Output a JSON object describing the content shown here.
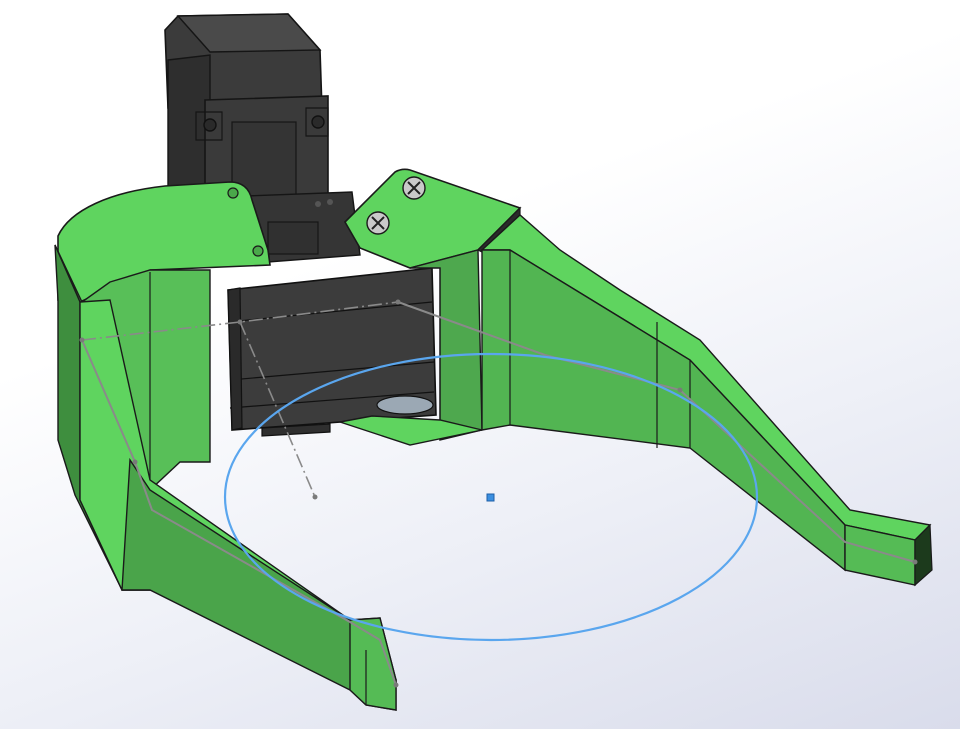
{
  "viewport": {
    "background_top": "#ffffff",
    "background_bottom": "#d9dceb"
  },
  "model": {
    "part_color_light": "#5fcf5f",
    "part_color_mid": "#52b552",
    "part_color_dark": "#3d8f3d",
    "servo_color": "#3a3a3a",
    "servo_color_dark": "#232323",
    "edge_color": "#1a1a1a"
  },
  "sketch": {
    "line_color": "#8a8a8a",
    "circle_color": "#5aa6ee",
    "center_point_color": "#3b8fe0"
  }
}
